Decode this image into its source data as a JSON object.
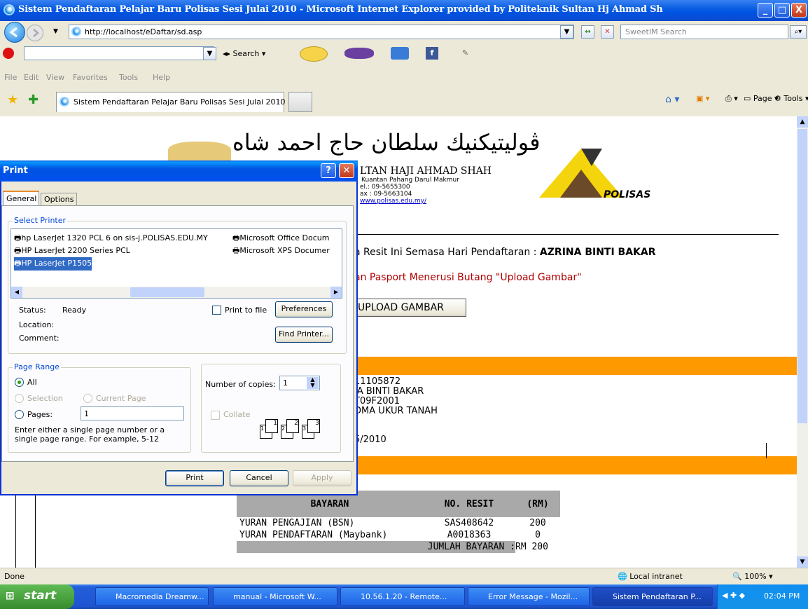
{
  "window": {
    "title": "Sistem Pendaftaran Pelajar Baru Polisas Sesi Julai 2010 - Microsoft Internet Explorer provided by Politeknik Sultan Hj Ahmad Sh",
    "min": "_",
    "max": "□",
    "close": "X"
  },
  "address": {
    "url": "http://localhost/eDaftar/sd.asp",
    "search_placeholder": "SweetIM Search"
  },
  "toolbar": {
    "search_label": "Search"
  },
  "menu": {
    "items": [
      "File",
      "Edit",
      "View",
      "Favorites",
      "Tools",
      "Help"
    ]
  },
  "tabs": {
    "active": "Sistem Pendaftaran Pelajar Baru Polisas Sesi Julai 2010",
    "page_label": "Page",
    "tools_label": "Tools"
  },
  "page": {
    "arabic_title": "ڤوليتيكنيك سلطان حاج احمد شاه",
    "inst_name": "LTAN HAJI AHMAD SHAH",
    "inst_addr": "Kuantan Pahang Darul Makmur",
    "tel": "el.: 09-5655300",
    "fax": "ax : 09-5663104",
    "web": "www.polisas.edu.my/",
    "logo_text": "POLISAS",
    "resit_line": "a Resit Ini Semasa Hari Pendaftaran : ",
    "student_name_bold": "AZRINA BINTI BAKAR",
    "upload_note": "an Pasport Menerusi Butang \"Upload Gambar\"",
    "upload_button": "UPLOAD GAMBAR",
    "info": [
      "11105872",
      "IA BINTI BAKAR",
      "T09F2001",
      "DMA UKUR TANAH"
    ],
    "date": "5/2010",
    "pay_headers": [
      "BAYARAN",
      "NO. RESIT",
      "(RM)"
    ],
    "pay_rows": [
      [
        "YURAN PENGAJIAN (BSN)",
        "SAS408642",
        "200"
      ],
      [
        "YURAN PENDAFTARAN (Maybank)",
        "A0018363",
        "0"
      ]
    ],
    "pay_total_label": "JUMLAH BAYARAN :",
    "pay_total_value": "RM 200"
  },
  "dialog": {
    "title": "Print",
    "tabs": [
      "General",
      "Options"
    ],
    "select_printer_label": "Select Printer",
    "printers": [
      "hp LaserJet 1320 PCL 6 on sis-j.POLISAS.EDU.MY",
      "HP LaserJet 2200 Series PCL",
      "HP LaserJet P1505",
      "Microsoft Office Docum",
      "Microsoft XPS Documer"
    ],
    "status_label": "Status:",
    "status_value": "Ready",
    "location_label": "Location:",
    "comment_label": "Comment:",
    "print_to_file": "Print to file",
    "preferences": "Preferences",
    "find_printer": "Find Printer...",
    "page_range_label": "Page Range",
    "range_all": "All",
    "range_selection": "Selection",
    "range_current": "Current Page",
    "range_pages": "Pages:",
    "pages_value": "1",
    "range_hint": "Enter either a single page number or a single page range.  For example, 5-12",
    "copies_label": "Number of copies:",
    "copies_value": "1",
    "collate": "Collate",
    "collate_icons": [
      "1",
      "1",
      "2",
      "2",
      "3",
      "3"
    ],
    "buttons": {
      "print": "Print",
      "cancel": "Cancel",
      "apply": "Apply"
    }
  },
  "status": {
    "left": "Done",
    "zone": "Local intranet",
    "zoom": "100%"
  },
  "taskbar": {
    "start": "start",
    "tasks": [
      "Macromedia Dreamw...",
      "manual - Microsoft W...",
      "10.56.1.20 - Remote...",
      "Error Message - Mozil...",
      "Sistem Pendaftaran P..."
    ],
    "clock": "02:04 PM"
  },
  "colors": {
    "xp_blue": "#0053e1",
    "orange_band": "#ff9900",
    "link": "#0000cc"
  }
}
